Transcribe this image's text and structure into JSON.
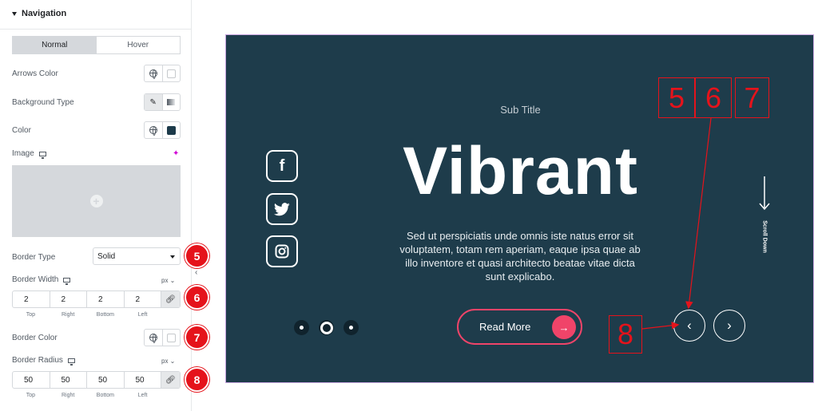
{
  "panel": {
    "section_title": "Navigation",
    "tabs": [
      {
        "label": "Normal",
        "active": true
      },
      {
        "label": "Hover",
        "active": false
      }
    ],
    "arrows_color_label": "Arrows Color",
    "background_type_label": "Background Type",
    "color_label": "Color",
    "image_label": "Image",
    "border_type_label": "Border Type",
    "border_type_value": "Solid",
    "border_width_label": "Border Width",
    "border_width_unit": "px",
    "border_width": {
      "top": "2",
      "right": "2",
      "bottom": "2",
      "left": "2"
    },
    "border_color_label": "Border Color",
    "border_radius_label": "Border Radius",
    "border_radius_unit": "px",
    "border_radius": {
      "top": "50",
      "right": "50",
      "bottom": "50",
      "left": "50"
    },
    "dim_labels": [
      "Top",
      "Right",
      "Bottom",
      "Left"
    ],
    "color_swatch": "#1c3a4a"
  },
  "preview": {
    "subtitle": "Sub Title",
    "headline": "Vibrant",
    "description": "Sed ut perspiciatis unde omnis iste natus error sit voluptatem, totam rem aperiam, eaque ipsa quae ab illo inventore et quasi architecto beatae vitae dicta sunt explicabo.",
    "button_label": "Read More",
    "scroll_label": "Scroll Down",
    "background_color": "#1e3c4b",
    "accent_color": "#f04469",
    "social_icons": [
      "facebook-icon",
      "twitter-icon",
      "instagram-icon"
    ],
    "pagination": {
      "count": 3,
      "active": 2
    }
  },
  "annotations": {
    "badges": [
      "5",
      "6",
      "7",
      "8"
    ],
    "boxes": [
      "5",
      "6",
      "7",
      "8"
    ],
    "color": "#e5131b"
  }
}
